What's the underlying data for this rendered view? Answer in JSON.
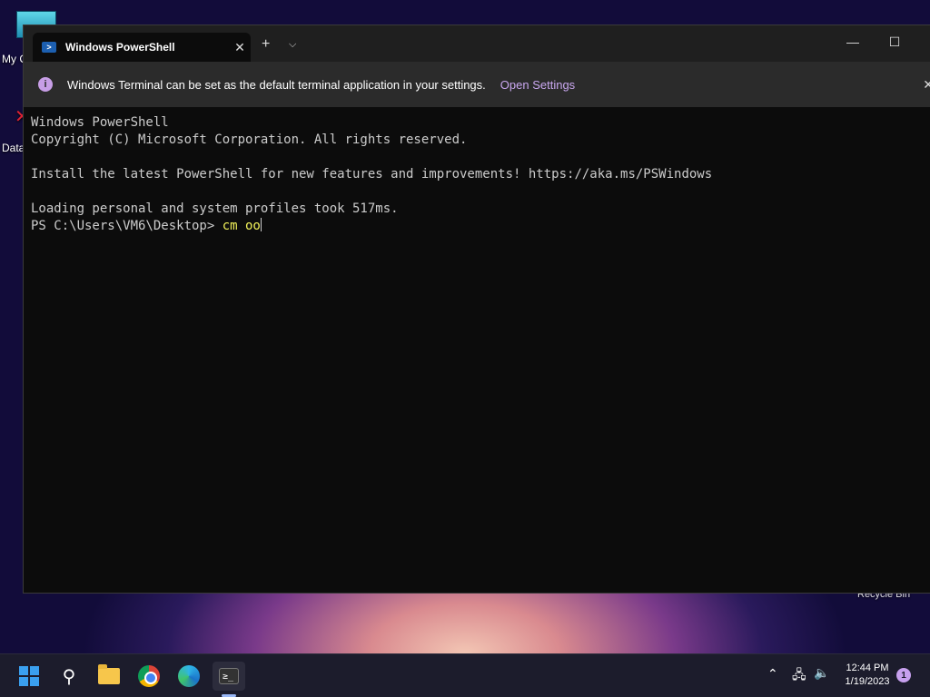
{
  "desktop": {
    "icons": [
      {
        "label": "My C"
      },
      {
        "label": "Data"
      },
      {
        "label": "Recycle Bin"
      }
    ]
  },
  "window": {
    "tab_title": "Windows PowerShell",
    "tab_close": "✕",
    "new_tab": "+",
    "dropdown": "⌵",
    "minimize": "—",
    "maximize": "☐"
  },
  "infobar": {
    "icon": "i",
    "message": "Windows Terminal can be set as the default terminal application in your settings.",
    "link": "Open Settings",
    "close": "✕"
  },
  "console": {
    "lines": [
      "Windows PowerShell",
      "Copyright (C) Microsoft Corporation. All rights reserved.",
      "",
      "Install the latest PowerShell for new features and improvements! https://aka.ms/PSWindows",
      "",
      "Loading personal and system profiles took 517ms."
    ],
    "prompt": "PS C:\\Users\\VM6\\Desktop> ",
    "command": "cm oo"
  },
  "taskbar": {
    "time": "12:44 PM",
    "date": "1/19/2023",
    "notification_count": "1",
    "terminal_glyph": "≥_"
  },
  "colors": {
    "accent": "#c9a7ef",
    "console_bg": "#0c0c0c",
    "command": "#f2f25a"
  }
}
